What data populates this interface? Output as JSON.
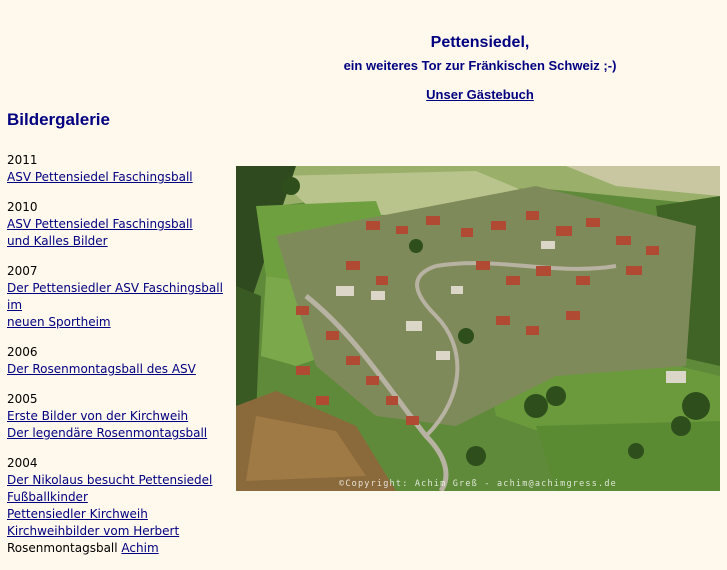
{
  "header": {
    "title": "Pettensiedel,",
    "subtitle": "ein weiteres Tor zur Fränkischen Schweiz ;-)",
    "guestbook_link": "Unser Gästebuch"
  },
  "gallery": {
    "heading": "Bildergalerie",
    "years": [
      {
        "year": "2011",
        "links": [
          "ASV Pettensiedel Faschingsball"
        ]
      },
      {
        "year": "2010",
        "links": [
          "ASV Pettensiedel Faschingsball",
          "und Kalles Bilder"
        ]
      },
      {
        "year": "2007",
        "links": [
          "Der Pettensiedler ASV Faschingsball im",
          "neuen Sportheim"
        ]
      },
      {
        "year": "2006",
        "links": [
          "Der Rosenmontagsball des ASV"
        ]
      },
      {
        "year": "2005",
        "links": [
          "Erste Bilder von der Kirchweih",
          "Der legendäre Rosenmontagsball"
        ]
      },
      {
        "year": "2004",
        "links": [
          "Der Nikolaus besucht Pettensiedel",
          "Fußballkinder",
          "Pettensiedler Kirchweih",
          "Kirchweihbilder vom Herbert"
        ],
        "mixed_line": {
          "text": "Rosenmontagsball ",
          "link": "Achim"
        }
      }
    ]
  },
  "photo": {
    "description_icon": "aerial-village-photo",
    "copyright": "©Copyright: Achim Greß - achim@achimgress.de"
  }
}
